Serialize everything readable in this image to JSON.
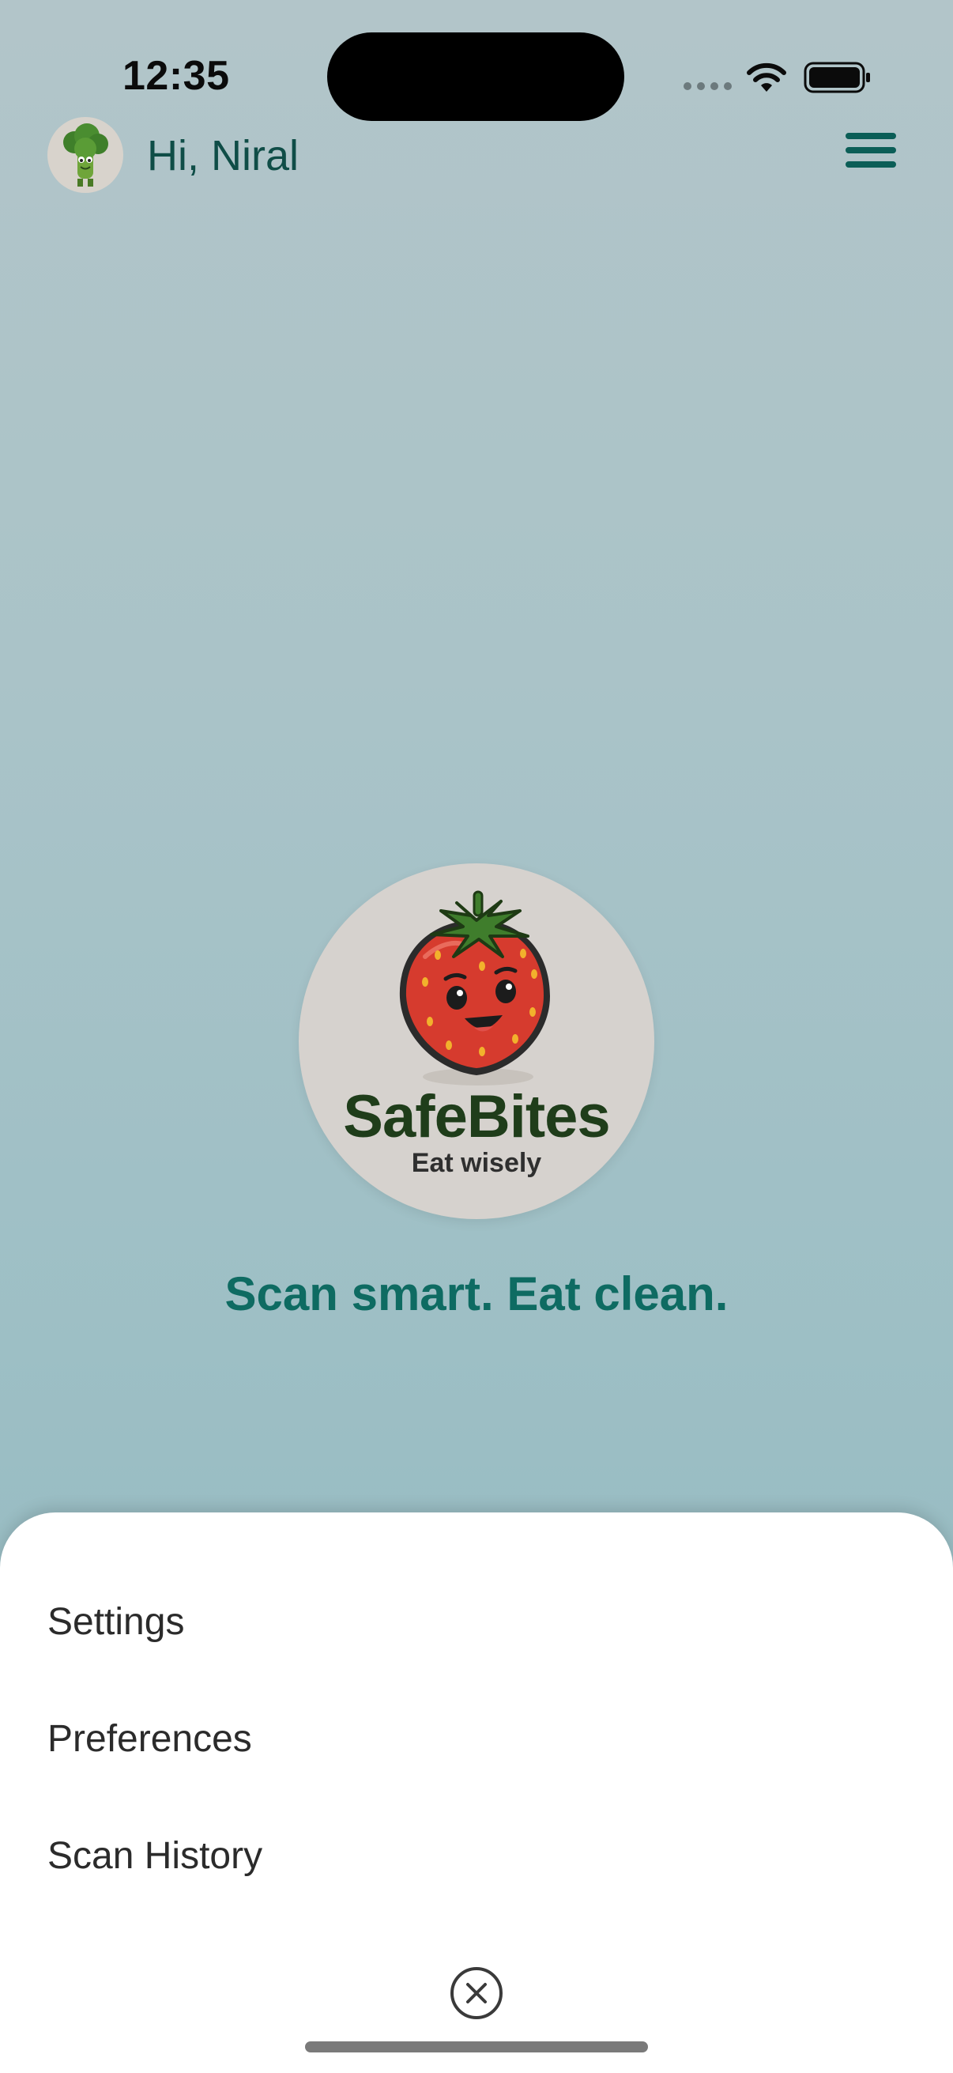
{
  "status_bar": {
    "time": "12:35",
    "icons": [
      "cellular-dots-icon",
      "wifi-icon",
      "battery-icon"
    ]
  },
  "header": {
    "greeting": "Hi, Niral",
    "avatar_icon": "broccoli-avatar-icon",
    "menu_icon": "hamburger-menu-icon"
  },
  "logo": {
    "name": "SafeBites",
    "tagline": "Eat wisely",
    "mascot_icon": "strawberry-mascot-icon"
  },
  "slogan": "Scan smart. Eat clean.",
  "menu_sheet": {
    "items": [
      {
        "label": "Settings"
      },
      {
        "label": "Preferences"
      },
      {
        "label": "Scan History"
      }
    ],
    "close_icon": "close-circle-icon"
  },
  "colors": {
    "accent": "#0e6b62",
    "header_text": "#0f4d47",
    "logo_text": "#1f3d1a",
    "background_top": "#b2c5c9",
    "background_bottom": "#8fb7be",
    "sheet_background": "#ffffff"
  }
}
